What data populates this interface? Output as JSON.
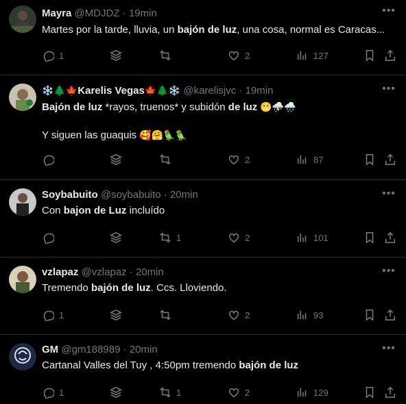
{
  "tweets": [
    {
      "name": "Mayra",
      "handle": "@MDJDZ",
      "time": "19min",
      "text_pre": "Martes por la tarde, lluvia, un ",
      "text_bold": "bajón de luz",
      "text_post": ", una cosa, normal es Caracas...",
      "replies": "1",
      "retweets": "",
      "likes": "2",
      "views": "127",
      "avatar_color": "#3a4a3a"
    },
    {
      "name_prefix": "❄️🌲🍁",
      "name": "Karelis Vegas",
      "name_suffix": "🍁🌲❄️",
      "handle": "@karelisjvc",
      "time": "19min",
      "l1_bold1": "Bajón de luz",
      "l1_mid": " *rayos, truenos* y subidón ",
      "l1_bold2": "de luz",
      "l1_emoji": " 😬⛈️🌧️",
      "l2": "Y siguen las guaquis ",
      "l2_emoji": "🥰🤗🦜🦜",
      "replies": "",
      "retweets": "",
      "likes": "2",
      "views": "87",
      "avatar_color": "#6a7a5a"
    },
    {
      "name": "Soybabuito",
      "handle": "@soybabuito",
      "time": "20min",
      "text_pre": "Con ",
      "text_bold": "bajon de Luz",
      "text_post": " incluído",
      "replies": "",
      "retweets": "1",
      "likes": "2",
      "views": "101",
      "avatar_color": "#55504a"
    },
    {
      "name": "vzlapaz",
      "handle": "@vzlapaz",
      "time": "20min",
      "text_pre": "Tremendo ",
      "text_bold": "bajón de luz",
      "text_post": ". Ccs. Lloviendo.",
      "replies": "1",
      "retweets": "",
      "likes": "2",
      "views": "93",
      "avatar_color": "#5a6a40"
    },
    {
      "name": "GM",
      "handle": "@gm188989",
      "time": "20min",
      "text_pre": "Cartanal Valles del Tuy , 4:50pm tremendo ",
      "text_bold": "bajón de luz",
      "text_post": "",
      "replies": "1",
      "retweets": "1",
      "likes": "2",
      "views": "129",
      "avatar_color": "#1d2a44"
    }
  ],
  "icons": {
    "reply": "reply-icon",
    "grok": "grok-stack-icon",
    "retweet": "retweet-icon",
    "like": "heart-icon",
    "views": "views-bar-chart-icon",
    "bookmark": "bookmark-icon",
    "share": "share-icon",
    "more": "more-dots-icon"
  },
  "separator": " · "
}
